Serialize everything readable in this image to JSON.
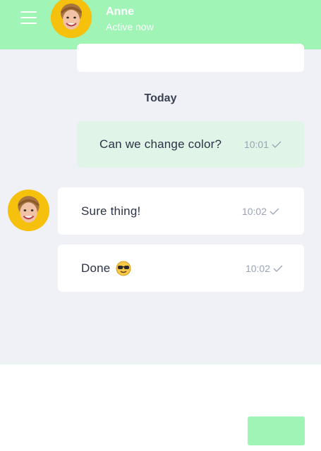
{
  "header": {
    "contact_name": "Anne",
    "contact_status": "Active now",
    "accent_color": "#9ff4b6"
  },
  "chat": {
    "day_label": "Today",
    "messages": [
      {
        "direction": "outgoing",
        "text": "Can we change color?",
        "time": "10:01",
        "status_icon": "check-icon"
      },
      {
        "direction": "incoming",
        "text": "Sure thing!",
        "time": "10:02",
        "status_icon": "check-icon"
      },
      {
        "direction": "incoming",
        "text": "Done",
        "emoji": "sunglasses-emoji",
        "time": "10:02",
        "status_icon": "check-icon"
      }
    ]
  },
  "composer": {
    "send_label": ""
  }
}
